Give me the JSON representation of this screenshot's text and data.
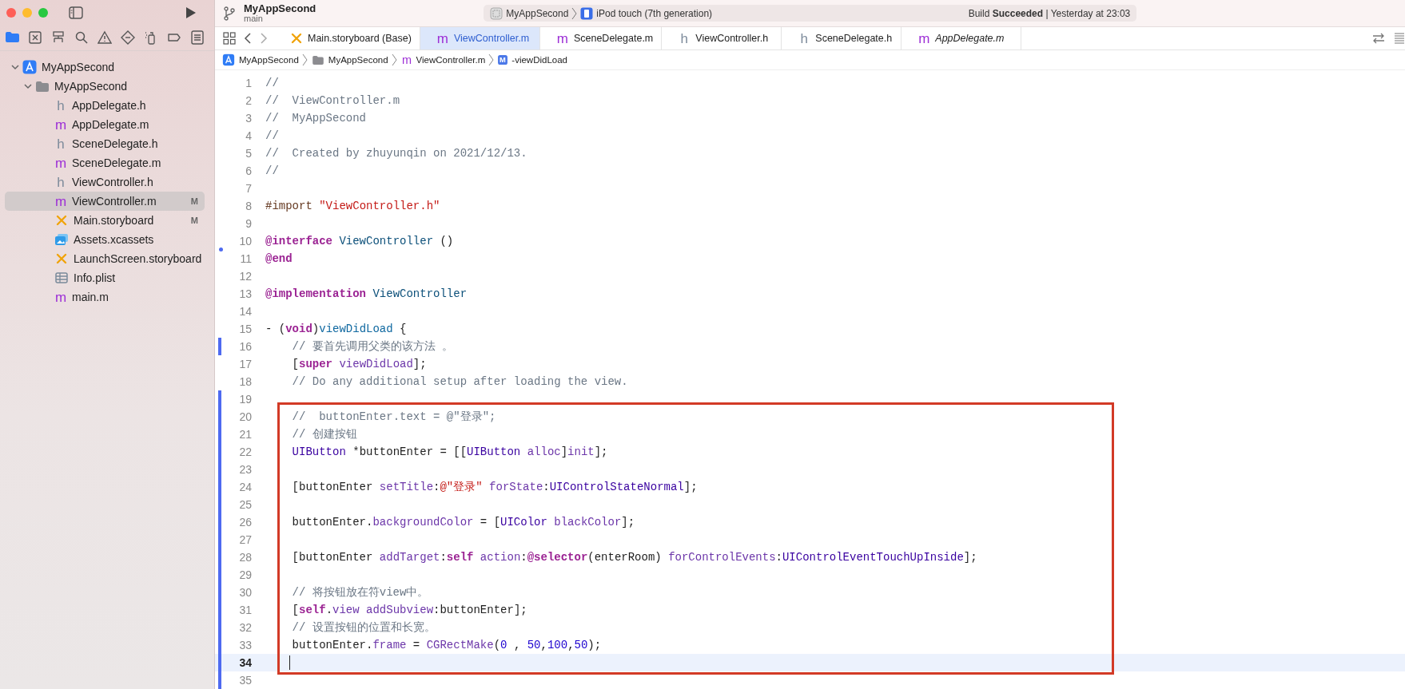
{
  "toolbar": {
    "project": "MyAppSecond",
    "branch": "main",
    "scheme": "MyAppSecond",
    "device": "iPod touch (7th generation)",
    "status": "Build **Succeeded** | Yesterday at 23:03"
  },
  "navigator_tabs": [
    {
      "selected": true
    },
    {
      "selected": false
    },
    {
      "selected": false
    },
    {
      "selected": false
    },
    {
      "selected": false
    },
    {
      "selected": false
    },
    {
      "selected": false
    },
    {
      "selected": false
    },
    {
      "selected": false
    }
  ],
  "tree": [
    {
      "label": "MyAppSecond",
      "kind": "project",
      "expanded": true,
      "children": [
        {
          "label": "MyAppSecond",
          "kind": "folder",
          "expanded": true,
          "children": [
            {
              "label": "AppDelegate.h",
              "kind": "header",
              "glyph": "h",
              "selected": false
            },
            {
              "label": "AppDelegate.m",
              "kind": "source",
              "glyph": "m",
              "selected": false
            },
            {
              "label": "SceneDelegate.h",
              "kind": "header",
              "glyph": "h",
              "selected": false
            },
            {
              "label": "SceneDelegate.m",
              "kind": "source",
              "glyph": "m",
              "selected": false
            },
            {
              "label": "ViewController.h",
              "kind": "header",
              "glyph": "h",
              "selected": false
            },
            {
              "label": "ViewController.m",
              "kind": "source",
              "glyph": "m",
              "selected": true,
              "status": "M"
            },
            {
              "label": "Main.storyboard",
              "kind": "storyboard",
              "selected": false,
              "status": "M"
            },
            {
              "label": "Assets.xcassets",
              "kind": "assets",
              "selected": false
            },
            {
              "label": "LaunchScreen.storyboard",
              "kind": "storyboard",
              "selected": false
            },
            {
              "label": "Info.plist",
              "kind": "plist",
              "selected": false
            },
            {
              "label": "main.m",
              "kind": "source",
              "glyph": "m",
              "selected": false
            }
          ]
        }
      ]
    }
  ],
  "tabs": [
    {
      "label": "Main.storyboard (Base)",
      "kind": "storyboard",
      "selected": false,
      "preview": false
    },
    {
      "label": "ViewController.m",
      "kind": "source",
      "glyph": "m",
      "selected": true,
      "preview": false
    },
    {
      "label": "SceneDelegate.m",
      "kind": "source",
      "glyph": "m",
      "selected": false,
      "preview": false
    },
    {
      "label": "ViewController.h",
      "kind": "header",
      "glyph": "h",
      "selected": false,
      "preview": false
    },
    {
      "label": "SceneDelegate.h",
      "kind": "header",
      "glyph": "h",
      "selected": false,
      "preview": false
    },
    {
      "label": "AppDelegate.m",
      "kind": "source",
      "glyph": "m",
      "selected": false,
      "preview": true
    }
  ],
  "breadcrumb": [
    {
      "label": "MyAppSecond",
      "kind": "project"
    },
    {
      "label": "MyAppSecond",
      "kind": "folder"
    },
    {
      "label": "ViewController.m",
      "kind": "source",
      "glyph": "m"
    },
    {
      "label": "-viewDidLoad",
      "kind": "method",
      "glyph": "M"
    }
  ],
  "editor": {
    "lines": [
      {
        "number": "1",
        "tokens": [
          {
            "text": "//",
            "kind": "comment"
          }
        ]
      },
      {
        "number": "2",
        "tokens": [
          {
            "text": "//  ViewController.m",
            "kind": "comment"
          }
        ]
      },
      {
        "number": "3",
        "tokens": [
          {
            "text": "//  MyAppSecond",
            "kind": "comment"
          }
        ]
      },
      {
        "number": "4",
        "tokens": [
          {
            "text": "//",
            "kind": "comment"
          }
        ]
      },
      {
        "number": "5",
        "tokens": [
          {
            "text": "//  Created by zhuyunqin on 2021/12/13.",
            "kind": "comment"
          }
        ]
      },
      {
        "number": "6",
        "tokens": [
          {
            "text": "//",
            "kind": "comment"
          }
        ]
      },
      {
        "number": "7"
      },
      {
        "number": "8",
        "tokens": [
          {
            "text": "#import ",
            "kind": "preproc"
          },
          {
            "text": "\"ViewController.h\"",
            "kind": "string"
          }
        ]
      },
      {
        "number": "9"
      },
      {
        "number": "10",
        "tokens": [
          {
            "text": "@interface",
            "kind": "keyword"
          },
          {
            "text": " ViewController",
            "kind": "type"
          },
          {
            "text": " ()",
            "kind": "plain"
          }
        ]
      },
      {
        "number": "11",
        "deleted": true,
        "tokens": [
          {
            "text": "@end",
            "kind": "keyword"
          }
        ]
      },
      {
        "number": "12"
      },
      {
        "number": "13",
        "tokens": [
          {
            "text": "@implementation",
            "kind": "keyword"
          },
          {
            "text": " ViewController",
            "kind": "type"
          }
        ]
      },
      {
        "number": "14"
      },
      {
        "number": "15",
        "tokens": [
          {
            "text": "- (",
            "kind": "plain"
          },
          {
            "text": "void",
            "kind": "keyword"
          },
          {
            "text": ")",
            "kind": "plain"
          },
          {
            "text": "viewDidLoad",
            "kind": "decl"
          },
          {
            "text": " {",
            "kind": "plain"
          }
        ]
      },
      {
        "number": "16",
        "modified": true,
        "tokens": [
          {
            "text": "    // 要首先调用父类的该方法 。",
            "kind": "comment"
          }
        ]
      },
      {
        "number": "17",
        "tokens": [
          {
            "text": "    [",
            "kind": "plain"
          },
          {
            "text": "super",
            "kind": "keyword"
          },
          {
            "text": " viewDidLoad",
            "kind": "method"
          },
          {
            "text": "];",
            "kind": "plain"
          }
        ]
      },
      {
        "number": "18",
        "tokens": [
          {
            "text": "    // Do any additional setup after loading the view.",
            "kind": "comment"
          }
        ]
      },
      {
        "number": "19",
        "modified": true
      },
      {
        "number": "20",
        "modified": true,
        "boxed": true,
        "tokens": [
          {
            "text": "    //  buttonEnter.text = @\"登录\";",
            "kind": "comment"
          }
        ]
      },
      {
        "number": "21",
        "modified": true,
        "boxed": true,
        "tokens": [
          {
            "text": "    // 创建按钮",
            "kind": "comment"
          }
        ]
      },
      {
        "number": "22",
        "modified": true,
        "boxed": true,
        "tokens": [
          {
            "text": "    UIButton",
            "kind": "class"
          },
          {
            "text": " *buttonEnter = [[",
            "kind": "plain"
          },
          {
            "text": "UIButton",
            "kind": "class"
          },
          {
            "text": " alloc",
            "kind": "method"
          },
          {
            "text": "]",
            "kind": "plain"
          },
          {
            "text": "init",
            "kind": "method"
          },
          {
            "text": "];",
            "kind": "plain"
          }
        ]
      },
      {
        "number": "23",
        "modified": true,
        "boxed": true
      },
      {
        "number": "24",
        "modified": true,
        "boxed": true,
        "tokens": [
          {
            "text": "    [buttonEnter ",
            "kind": "plain"
          },
          {
            "text": "setTitle",
            "kind": "method"
          },
          {
            "text": ":",
            "kind": "plain"
          },
          {
            "text": "@\"登录\"",
            "kind": "string"
          },
          {
            "text": " forState",
            "kind": "method"
          },
          {
            "text": ":",
            "kind": "plain"
          },
          {
            "text": "UIControlStateNormal",
            "kind": "class"
          },
          {
            "text": "];",
            "kind": "plain"
          }
        ]
      },
      {
        "number": "25",
        "modified": true,
        "boxed": true
      },
      {
        "number": "26",
        "modified": true,
        "boxed": true,
        "tokens": [
          {
            "text": "    buttonEnter.",
            "kind": "plain"
          },
          {
            "text": "backgroundColor",
            "kind": "method"
          },
          {
            "text": " = [",
            "kind": "plain"
          },
          {
            "text": "UIColor",
            "kind": "class"
          },
          {
            "text": " blackColor",
            "kind": "method"
          },
          {
            "text": "];",
            "kind": "plain"
          }
        ]
      },
      {
        "number": "27",
        "modified": true,
        "boxed": true
      },
      {
        "number": "28",
        "modified": true,
        "boxed": true,
        "tokens": [
          {
            "text": "    [buttonEnter ",
            "kind": "plain"
          },
          {
            "text": "addTarget",
            "kind": "method"
          },
          {
            "text": ":",
            "kind": "plain"
          },
          {
            "text": "self",
            "kind": "keyword"
          },
          {
            "text": " action",
            "kind": "method"
          },
          {
            "text": ":",
            "kind": "plain"
          },
          {
            "text": "@selector",
            "kind": "keyword"
          },
          {
            "text": "(enterRoom) ",
            "kind": "plain"
          },
          {
            "text": "forControlEvents",
            "kind": "method"
          },
          {
            "text": ":",
            "kind": "plain"
          },
          {
            "text": "UIControlEventTouchUpInside",
            "kind": "class"
          },
          {
            "text": "];",
            "kind": "plain"
          }
        ]
      },
      {
        "number": "29",
        "modified": true,
        "boxed": true
      },
      {
        "number": "30",
        "modified": true,
        "boxed": true,
        "tokens": [
          {
            "text": "    // 将按钮放在符view中。",
            "kind": "comment"
          }
        ]
      },
      {
        "number": "31",
        "modified": true,
        "boxed": true,
        "tokens": [
          {
            "text": "    [",
            "kind": "plain"
          },
          {
            "text": "self",
            "kind": "keyword"
          },
          {
            "text": ".",
            "kind": "plain"
          },
          {
            "text": "view",
            "kind": "method"
          },
          {
            "text": " addSubview",
            "kind": "method"
          },
          {
            "text": ":buttonEnter];",
            "kind": "plain"
          }
        ]
      },
      {
        "number": "32",
        "modified": true,
        "boxed": true,
        "tokens": [
          {
            "text": "    // 设置按钮的位置和长宽。",
            "kind": "comment"
          }
        ]
      },
      {
        "number": "33",
        "modified": true,
        "boxed": true,
        "tokens": [
          {
            "text": "    buttonEnter.",
            "kind": "plain"
          },
          {
            "text": "frame",
            "kind": "method"
          },
          {
            "text": " = ",
            "kind": "plain"
          },
          {
            "text": "CGRectMake",
            "kind": "method"
          },
          {
            "text": "(",
            "kind": "plain"
          },
          {
            "text": "0",
            "kind": "number"
          },
          {
            "text": " , ",
            "kind": "plain"
          },
          {
            "text": "50",
            "kind": "number"
          },
          {
            "text": ",",
            "kind": "plain"
          },
          {
            "text": "100",
            "kind": "number"
          },
          {
            "text": ",",
            "kind": "plain"
          },
          {
            "text": "50",
            "kind": "number"
          },
          {
            "text": ");",
            "kind": "plain"
          }
        ]
      },
      {
        "number": "34",
        "modified": true,
        "boxed": true,
        "current": true,
        "cursor": true
      },
      {
        "number": "35",
        "modified": true
      }
    ]
  }
}
